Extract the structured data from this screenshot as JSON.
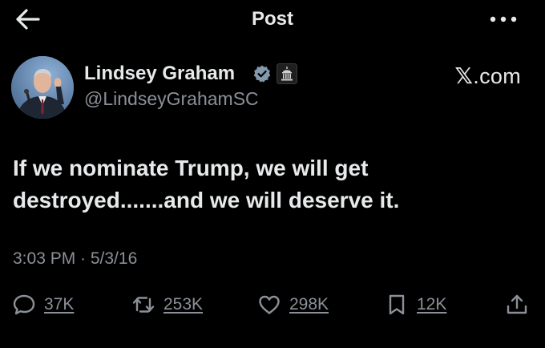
{
  "header": {
    "title": "Post",
    "back_icon": "back-arrow-icon",
    "more_icon": "more-horizontal-icon"
  },
  "author": {
    "name": "Lindsey Graham",
    "handle": "@LindseyGrahamSC",
    "verified": true,
    "verified_color": "#829aab",
    "badge_icon": "government-building-icon",
    "avatar_icon": "profile-photo"
  },
  "source": {
    "x": "𝕏",
    "domain": ".com"
  },
  "tweet": {
    "text": "If we nominate Trump, we will get destroyed.......and we will deserve it."
  },
  "meta": {
    "timestamp": "3:03 PM · 5/3/16"
  },
  "actions": {
    "replies": "37K",
    "reposts": "253K",
    "likes": "298K",
    "bookmarks": "12K"
  },
  "colors": {
    "background": "#000000",
    "text": "#e7e9ea",
    "secondary": "#8b9098"
  }
}
